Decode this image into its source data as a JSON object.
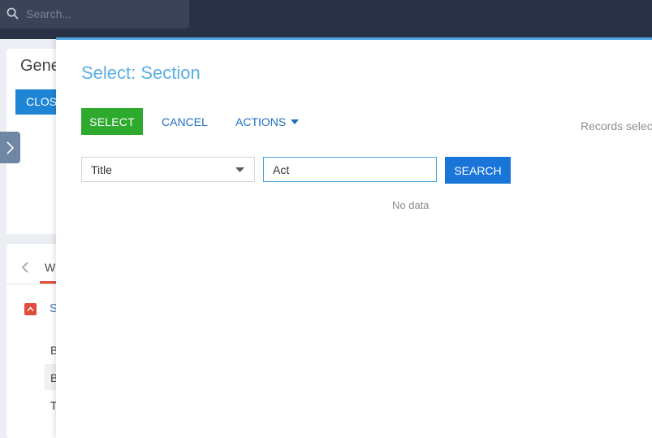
{
  "topbar": {
    "search_placeholder": "Search..."
  },
  "background": {
    "page_title": "General",
    "close_label": "CLOSE",
    "tab_label": "WHAT",
    "section_label": "S",
    "rows": [
      "B",
      "B",
      "T"
    ]
  },
  "modal": {
    "title": "Select: Section",
    "select_label": "SELECT",
    "cancel_label": "CANCEL",
    "actions_label": "ACTIONS",
    "records_label": "Records selected",
    "filter": {
      "column": "Title",
      "value": "Act"
    },
    "search_label": "SEARCH",
    "empty_message": "No data"
  },
  "colors": {
    "topbar": "#2a3248",
    "accent": "#4aa3df",
    "select_button": "#2eab2e",
    "search_button": "#1a75d8",
    "link": "#1f6fbf"
  }
}
